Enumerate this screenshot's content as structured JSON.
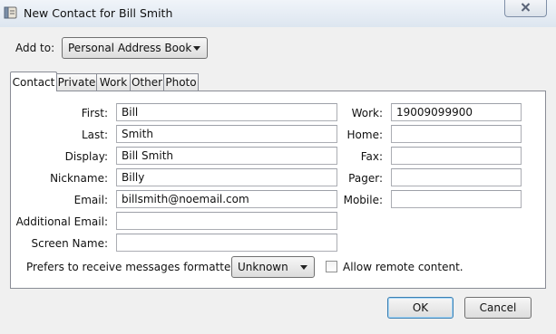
{
  "window": {
    "title": "New Contact for Bill Smith",
    "icon": "address-book-icon"
  },
  "add_to": {
    "label": "Add to:",
    "value": "Personal Address Book"
  },
  "tabs": [
    {
      "label": "Contact",
      "active": true
    },
    {
      "label": "Private"
    },
    {
      "label": "Work"
    },
    {
      "label": "Other"
    },
    {
      "label": "Photo"
    }
  ],
  "contact": {
    "first": {
      "label": "First:",
      "value": "Bill"
    },
    "last": {
      "label": "Last:",
      "value": "Smith"
    },
    "display": {
      "label": "Display:",
      "value": "Bill Smith"
    },
    "nickname": {
      "label": "Nickname:",
      "value": "Billy"
    },
    "email": {
      "label": "Email:",
      "value": "billsmith@noemail.com"
    },
    "additional_email": {
      "label": "Additional Email:",
      "value": ""
    },
    "screen_name": {
      "label": "Screen Name:",
      "value": ""
    }
  },
  "phones": {
    "work": {
      "label": "Work:",
      "value": "19009099900"
    },
    "home": {
      "label": "Home:",
      "value": ""
    },
    "fax": {
      "label": "Fax:",
      "value": ""
    },
    "pager": {
      "label": "Pager:",
      "value": ""
    },
    "mobile": {
      "label": "Mobile:",
      "value": ""
    }
  },
  "format": {
    "label": "Prefers to receive messages formatted as:",
    "value": "Unknown"
  },
  "remote_content": {
    "label": "Allow remote content.",
    "checked": false
  },
  "buttons": {
    "ok": "OK",
    "cancel": "Cancel"
  }
}
